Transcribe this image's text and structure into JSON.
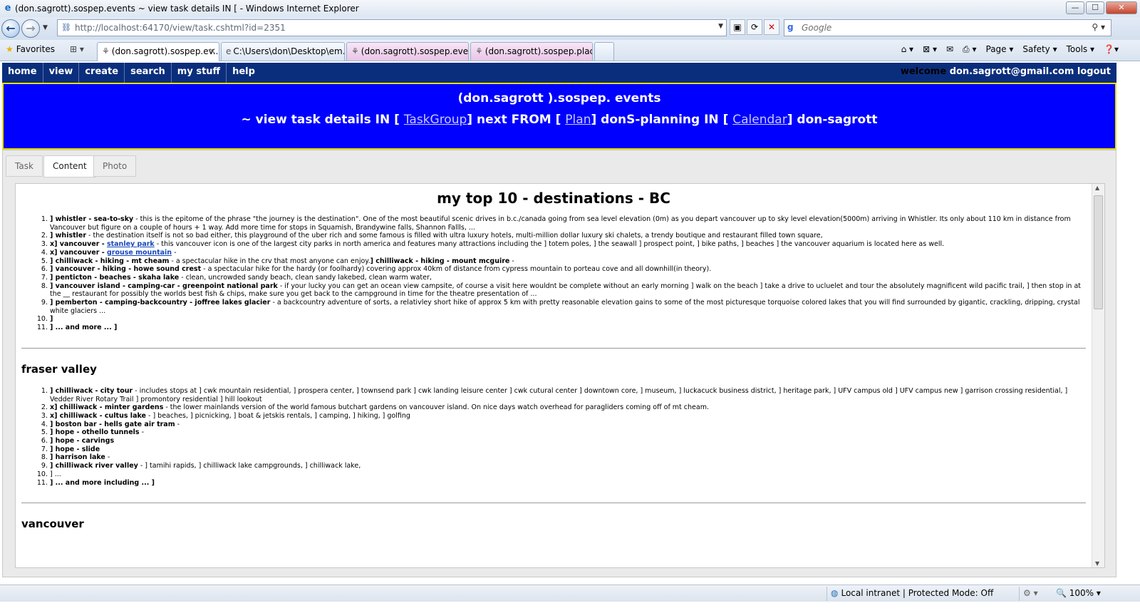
{
  "window": {
    "title": "(don.sagrott).sospep.events ~ view task details IN [ - Windows Internet Explorer",
    "min": "—",
    "max": "☐",
    "close": "✕"
  },
  "address": {
    "url": "http://localhost:64170/view/task.cshtml?id=2351",
    "search_placeholder": "Google"
  },
  "tabs_bar": {
    "favorites": "Favorites",
    "tabs": [
      {
        "label": "(don.sagrott).sospep.ev..."
      },
      {
        "label": "C:\\Users\\don\\Desktop\\em..."
      },
      {
        "label": "(don.sagrott).sospep.event..."
      },
      {
        "label": "(don.sagrott).sospep.place..."
      }
    ],
    "commands": [
      "Page ▾",
      "Safety ▾",
      "Tools ▾",
      "❓▾"
    ]
  },
  "sitenav": {
    "items": [
      "home",
      "view",
      "create",
      "search",
      "my stuff",
      "help"
    ],
    "welcome_word": "welcome",
    "user": "don.sagrott@gmail.com",
    "logout": "logout"
  },
  "banner": {
    "line1": "(don.sagrott ).sospep. events",
    "line2_a": "~ view task details IN [",
    "taskgroup": "TaskGroup",
    "line2_b": "] next FROM [",
    "plan": "Plan",
    "line2_c": "] donS-planning IN [",
    "calendar": "Calendar",
    "line2_d": "] don-sagrott"
  },
  "panel_tabs": [
    "Task",
    "Content",
    "Photo"
  ],
  "content": {
    "title": "my top 10 - destinations - BC",
    "top_list": [
      {
        "b": "] whistler - sea-to-sky",
        "t": " - this is the epitome of the phrase \"the journey is the destination\". One of the most beautiful scenic drives in b.c./canada going from sea level elevation (0m) as you depart vancouver up to sky level elevation(5000m) arriving in Whistler. Its only about 110 km in distance from Vancouver but figure on a couple of hours + 1 way. Add more time for stops in Squamish, Brandywine falls, Shannon Fallls, ..."
      },
      {
        "b": "] whistler",
        "t": " - the destination itself is not so bad either, this playground of the uber rich and some famous is filled with ultra luxury hotels, multi-million dollar luxury ski chalets, a trendy boutique and restaurant filled town square,"
      },
      {
        "b": "x] vancouver - ",
        "link": "stanley park",
        "t": " - this vancouver icon is one of the largest city parks in north america and features many attractions including the ] totem poles, ] the seawall ] prospect point, ] bike paths, ] beaches ] the vancouver aquarium is located here as well."
      },
      {
        "b": "x] vancouver - ",
        "link": "grouse mountain",
        "t": " -"
      },
      {
        "b": "] chilliwack - hiking - mt cheam",
        "t": " - a spectacular hike in the crv that most anyone can enjoy.",
        "b2": "] chilliwack - hiking - mount mcguire",
        "t2": " -"
      },
      {
        "b": "] vancouver - hiking - howe sound crest",
        "t": " - a spectacular hike for the hardy (or foolhardy) covering approx 40km of distance from cypress mountain to porteau cove and all downhill(in theory)."
      },
      {
        "b": "] penticton - beaches - skaha lake",
        "t": " - clean, uncrowded sandy beach, clean sandy lakebed, clean warm water,"
      },
      {
        "b": "] vancouver island - camping-car - greenpoint national park",
        "t": " - if your lucky you can get an ocean view campsite, of course a visit here wouldnt be complete without an early morning ] walk on the beach ] take a drive to ucluelet and tour the absolutely magnificent wild pacific trail, ] then stop in at the __ restaurant for possibly the worlds best fish & chips, make sure you get back to the campground in time for the theatre presentation of ..."
      },
      {
        "b": "] pemberton - camping-backcountry - joffree lakes glacier",
        "t": " - a backcountry adventure of sorts, a relativley short hike of approx 5 km with pretty reasonable elevation gains to some of the most picturesque torquoise colored lakes that you will find surrounded by gigantic, crackling, dripping, crystal white glaciers ..."
      },
      {
        "b": "]",
        "t": ""
      },
      {
        "b": "] ... and more ... ]",
        "t": ""
      }
    ],
    "section2": "fraser valley",
    "fv_list": [
      {
        "b": "] chilliwack - city tour",
        "t": " - includes stops at ] cwk mountain residential, ] prospera center, ] townsend park ] cwk landing leisure center ] cwk cutural center ] downtown core, ] museum, ] luckacuck business district, ] heritage park, ] UFV campus old ] UFV campus new ] garrison crossing residential, ] Vedder River Rotary Trail ] promontory residential ] hill lookout"
      },
      {
        "b": "x] chilliwack - minter gardens",
        "t": " - the lower mainlands version of the world famous butchart gardens on vancouver island. On nice days watch overhead for paragliders coming off of mt cheam."
      },
      {
        "b": "x] chilliwack - cultus lake",
        "t": " - ] beaches, ] picnicking, ] boat & jetskis rentals, ] camping, ] hiking, ] golfing"
      },
      {
        "b": "] boston bar - hells gate air tram",
        "t": " -"
      },
      {
        "b": "] hope - othello tunnels",
        "t": " -"
      },
      {
        "b": "] hope - carvings",
        "t": ""
      },
      {
        "b": "] hope - slide",
        "t": ""
      },
      {
        "b": "] harrison lake",
        "t": " -"
      },
      {
        "b": "] chilliwack river valley",
        "t": " - ] tamihi rapids, ] chilliwack lake campgrounds, ] chilliwack lake,"
      },
      {
        "b": "",
        "t": "] ..."
      },
      {
        "b": "] ... and more including ... ]",
        "t": ""
      }
    ],
    "section3": "vancouver"
  },
  "status": {
    "zone": "Local intranet | Protected Mode: Off",
    "zoom": "100%"
  }
}
